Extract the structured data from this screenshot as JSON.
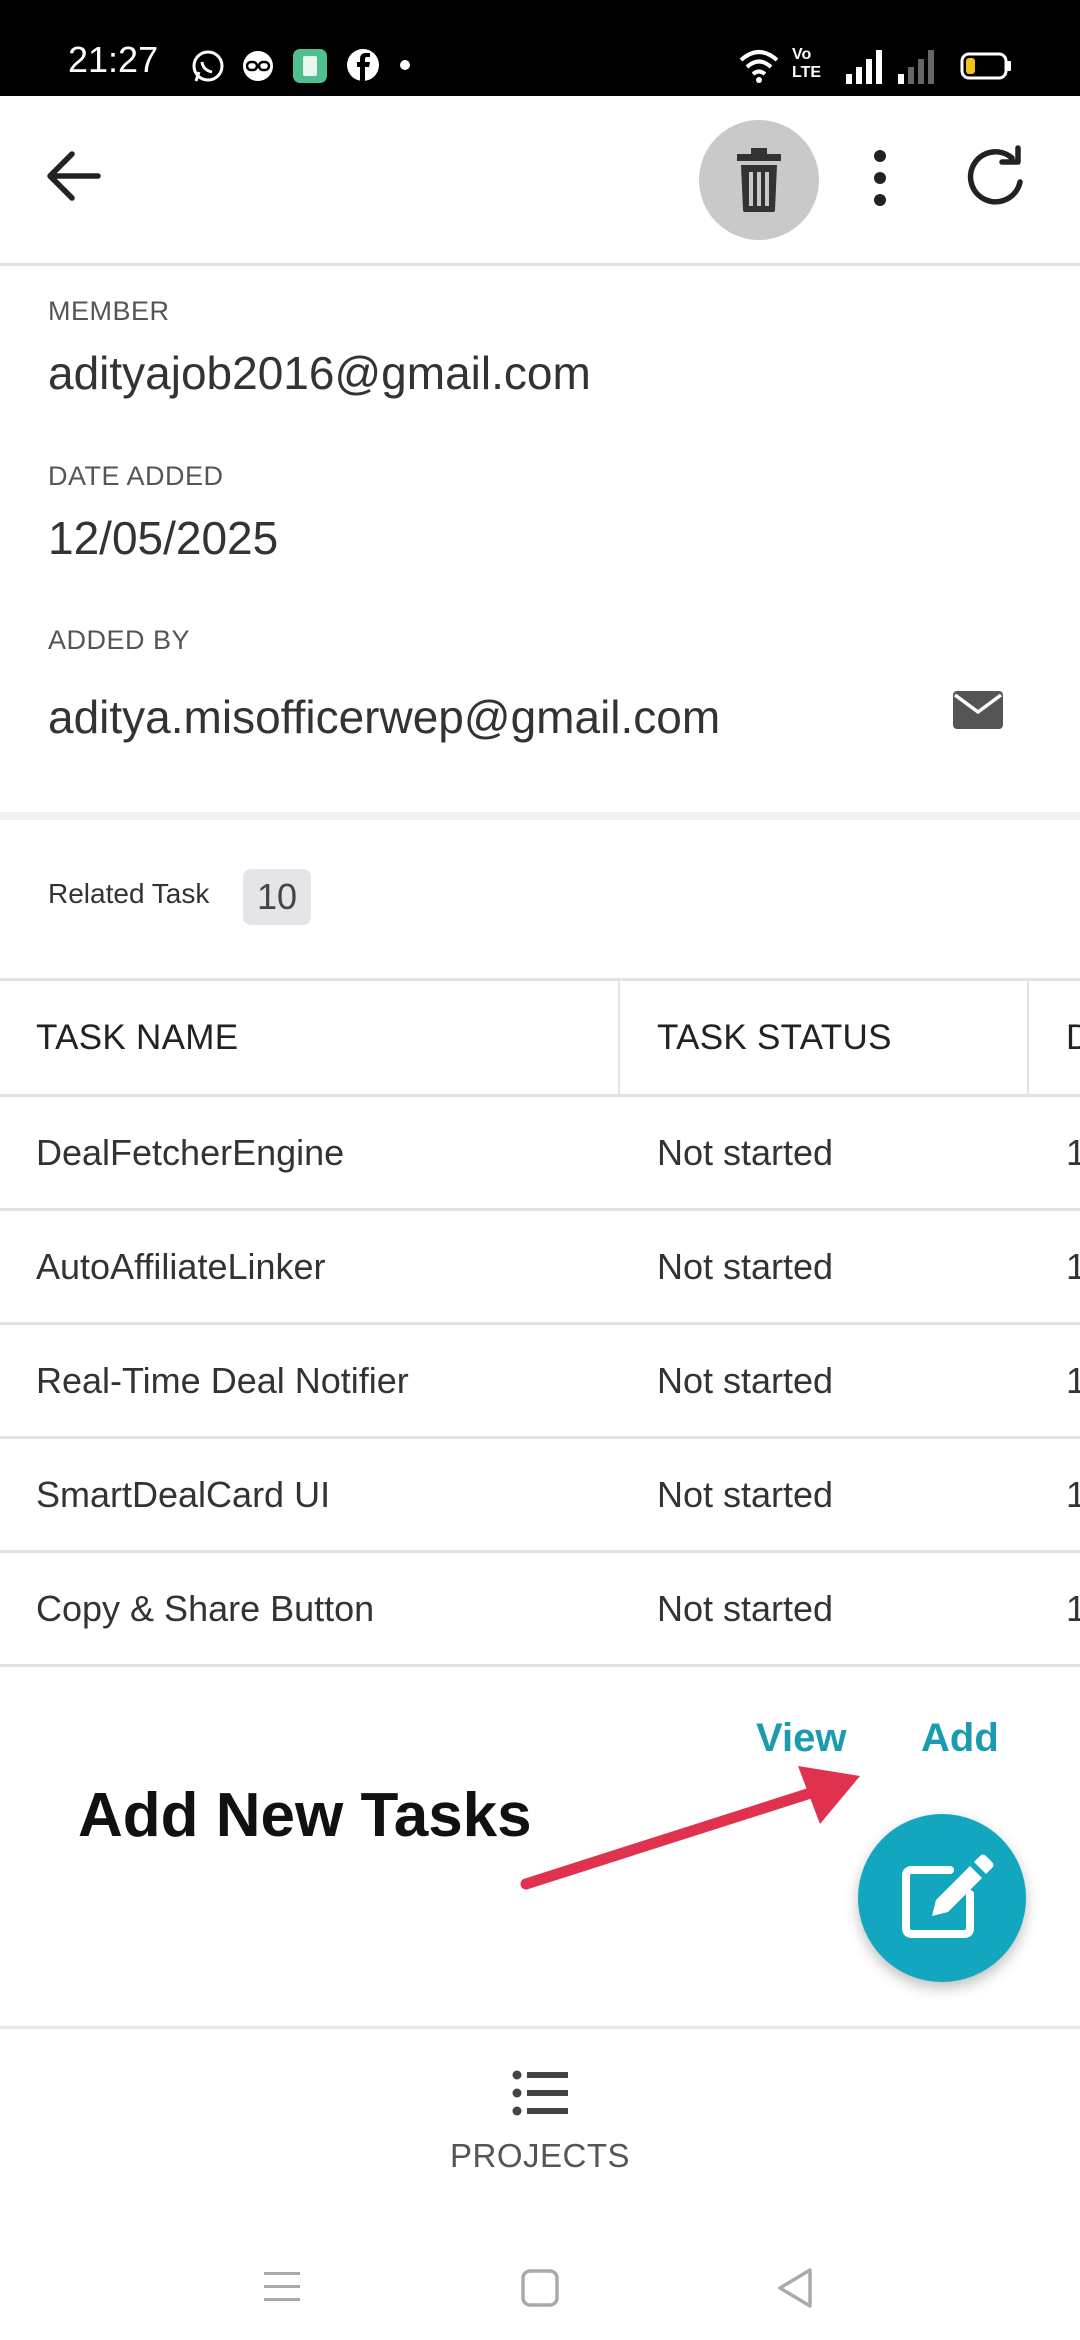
{
  "status_bar": {
    "time": "21:27",
    "icons": [
      "whatsapp-icon",
      "link-icon",
      "calculator-icon",
      "facebook-icon",
      "dot-icon",
      "wifi-icon",
      "volte-icon",
      "signal-icon",
      "signal-icon",
      "battery-icon"
    ],
    "network_text_top": "Vo",
    "network_text_bottom": "LTE"
  },
  "app_bar": {
    "icons": [
      "back-arrow-icon",
      "trash-icon",
      "more-vert-icon",
      "refresh-icon"
    ]
  },
  "details": {
    "member_label": "MEMBER",
    "member_value": "adityajob2016@gmail.com",
    "date_added_label": "DATE ADDED",
    "date_added_value": "12/05/2025",
    "added_by_label": "ADDED BY",
    "added_by_value": "aditya.misofficerwep@gmail.com"
  },
  "related": {
    "label": "Related Task",
    "count": "10"
  },
  "table": {
    "headers": [
      "TASK NAME",
      "TASK STATUS",
      "D"
    ],
    "rows": [
      [
        "DealFetcherEngine",
        "Not started",
        "1"
      ],
      [
        "AutoAffiliateLinker",
        "Not started",
        "1"
      ],
      [
        "Real-Time Deal Notifier",
        "Not started",
        "1"
      ],
      [
        "SmartDealCard UI",
        "Not started",
        "1"
      ],
      [
        "Copy & Share Button",
        "Not started",
        "1"
      ]
    ]
  },
  "actions": {
    "view_label": "View",
    "add_label": "Add"
  },
  "annotation": {
    "text": "Add New Tasks",
    "arrow_color": "#e0314f"
  },
  "bottom_nav": {
    "projects_label": "PROJECTS"
  },
  "colors": {
    "accent": "#13a7bf",
    "link": "#1a9bb0",
    "status_bar": "#000000"
  }
}
